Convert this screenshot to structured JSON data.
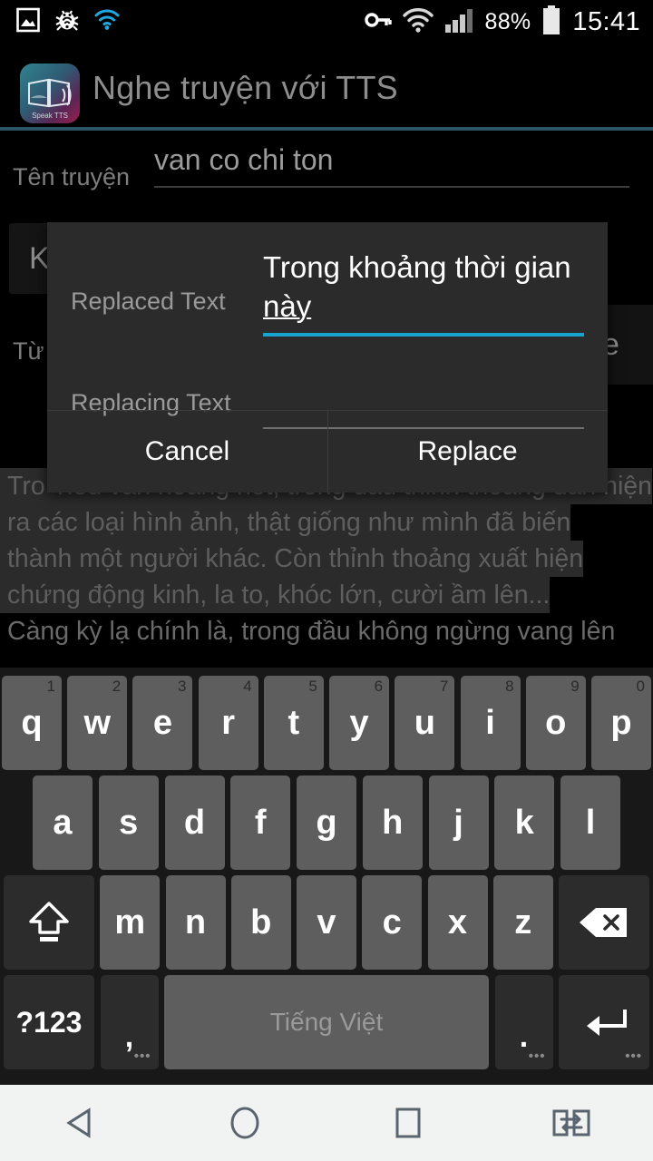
{
  "statusbar": {
    "left_icons": [
      "screenshot-icon",
      "debug-bug-icon",
      "wifi-blue-icon"
    ],
    "vpn_icon": "vpn-key-icon",
    "wifi_icon": "wifi-icon",
    "signal_icon": "cellular-signal-icon",
    "battery_percent": "88%",
    "battery_icon": "battery-icon",
    "time": "15:41"
  },
  "titlebar": {
    "app_icon_label": "Speak TTS",
    "title": "Nghe truyện với TTS",
    "divider_color": "#2c5566"
  },
  "background_form": {
    "story_name_label": "Tên truyện",
    "story_name_value": "van co chi ton",
    "left_button_partial": "K",
    "word_label": "Từ",
    "right_button_partial": "e",
    "story_lines": [
      {
        "text": "Tro",
        "selected": true
      },
      {
        "text": "Tiêu vẫn hoảng hốt, trong đầu thỉnh thoảng dần hiện",
        "selected": true
      },
      {
        "text": "ra các loại hình ảnh, thật giống như mình đã biến",
        "selected": true
      },
      {
        "text": "thành một người khác. Còn thỉnh thoảng xuất hiện",
        "selected": true
      },
      {
        "text": "chứng động kinh, la to, khóc lớn, cười ầm lên...",
        "selected": true
      },
      {
        "text": "Càng kỳ lạ chính là, trong đầu không ngừng vang lên",
        "selected": false
      }
    ]
  },
  "dialog": {
    "replaced_label": "Replaced Text",
    "replaced_value_part1": "Trong khoảng thời gian ",
    "replaced_value_underlined": "này",
    "replacing_label": "Replacing Text",
    "replacing_value": "",
    "accent_color": "#17a5cf",
    "cancel_label": "Cancel",
    "replace_label": "Replace"
  },
  "keyboard": {
    "row1": [
      {
        "key": "q",
        "num": "1"
      },
      {
        "key": "w",
        "num": "2"
      },
      {
        "key": "e",
        "num": "3"
      },
      {
        "key": "r",
        "num": "4"
      },
      {
        "key": "t",
        "num": "5"
      },
      {
        "key": "y",
        "num": "6"
      },
      {
        "key": "u",
        "num": "7"
      },
      {
        "key": "i",
        "num": "8"
      },
      {
        "key": "o",
        "num": "9"
      },
      {
        "key": "p",
        "num": "0"
      }
    ],
    "row2": [
      {
        "key": "a"
      },
      {
        "key": "s"
      },
      {
        "key": "d"
      },
      {
        "key": "f"
      },
      {
        "key": "g"
      },
      {
        "key": "h"
      },
      {
        "key": "j"
      },
      {
        "key": "k"
      },
      {
        "key": "l"
      }
    ],
    "row3": [
      {
        "key": "z"
      },
      {
        "key": "x"
      },
      {
        "key": "c"
      },
      {
        "key": "v"
      },
      {
        "key": "b"
      },
      {
        "key": "n"
      },
      {
        "key": "m"
      }
    ],
    "shift_icon": "shift-arrow-icon",
    "backspace_icon": "backspace-icon",
    "symbols_label": "?123",
    "comma_label": ",",
    "space_label": "Tiếng Việt",
    "period_label": ".",
    "enter_icon": "enter-arrow-icon"
  },
  "navbar": {
    "back_icon": "back-triangle-icon",
    "home_icon": "home-circle-icon",
    "recents_icon": "recents-square-icon",
    "switch_icon": "switch-pages-icon"
  }
}
